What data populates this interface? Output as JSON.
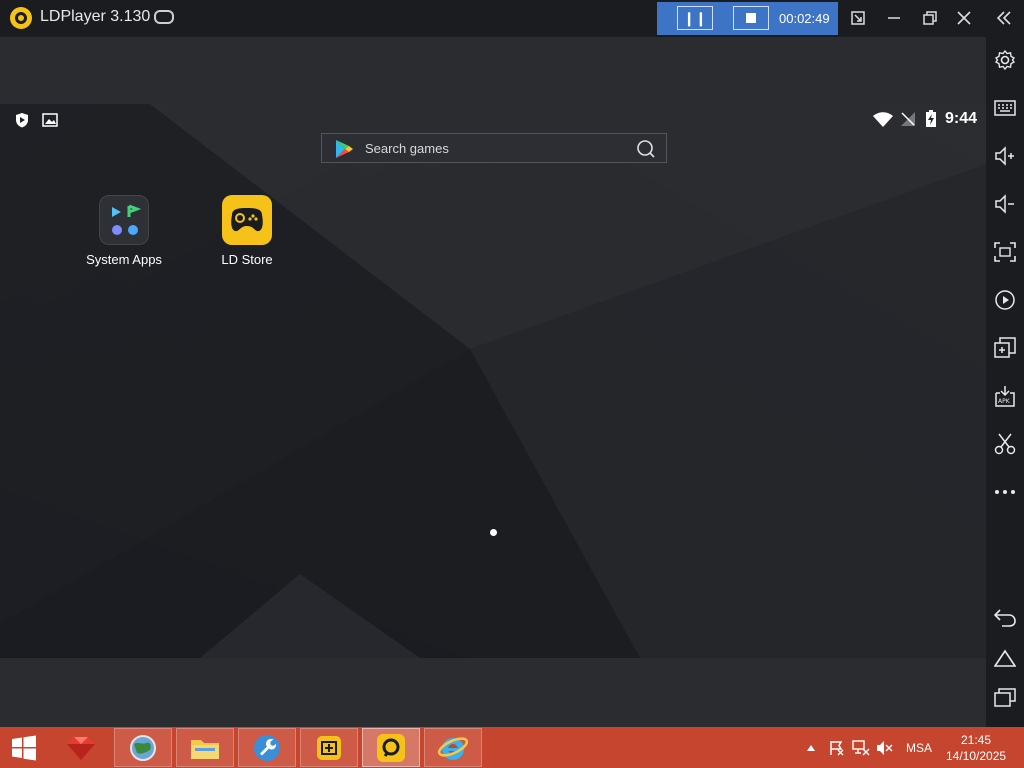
{
  "window": {
    "title": "LDPlayer 3.130",
    "recording_time": "00:02:49"
  },
  "android": {
    "clock": "9:44",
    "search": {
      "placeholder": "Search games"
    },
    "apps": [
      {
        "label": "System Apps"
      },
      {
        "label": "LD Store"
      }
    ]
  },
  "sidebar_icons": [
    "settings-icon",
    "keyboard-icon",
    "volume-up-icon",
    "volume-down-icon",
    "fullscreen-icon",
    "rotate-icon",
    "multi-instance-icon",
    "apk-install-icon",
    "scissors-icon",
    "more-icon",
    "back-icon",
    "home-icon",
    "recent-apps-icon"
  ],
  "taskbar": {
    "tray_lang": "MSA",
    "time": "21:45",
    "date": "14/10/2025"
  },
  "colors": {
    "accent": "#3d74c6",
    "taskbar": "#c6452e",
    "ld_yellow": "#f6c21a"
  }
}
